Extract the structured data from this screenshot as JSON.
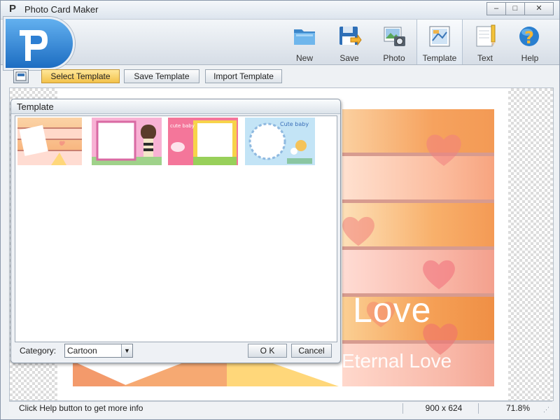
{
  "window": {
    "title": "Photo Card Maker",
    "buttons": {
      "minimize": "–",
      "maximize": "□",
      "close": "✕"
    }
  },
  "toolbar": {
    "items": [
      {
        "label": "New",
        "icon": "folder-icon"
      },
      {
        "label": "Save",
        "icon": "save-icon"
      },
      {
        "label": "Photo",
        "icon": "photo-icon"
      },
      {
        "label": "Template",
        "icon": "template-icon",
        "active": true
      },
      {
        "label": "Text",
        "icon": "text-icon"
      },
      {
        "label": "Help",
        "icon": "help-icon"
      }
    ]
  },
  "subtoolbar": {
    "select_label": "Select Template",
    "save_label": "Save Template",
    "import_label": "Import Template"
  },
  "canvas": {
    "love_text": "Love",
    "eternal_text": "Eternal Love"
  },
  "dialog": {
    "title": "Template",
    "thumbnails": [
      {
        "name": "pink-orange-planks",
        "colors": [
          "#f7b27a",
          "#ffd0c8"
        ]
      },
      {
        "name": "pink-frame-kid",
        "colors": [
          "#f59bc4",
          "#ffffff"
        ]
      },
      {
        "name": "cute-baby-pink",
        "colors": [
          "#f36c8f",
          "#f7e24f"
        ],
        "text": "cute baby"
      },
      {
        "name": "cute-baby-blue",
        "colors": [
          "#a9d6f2",
          "#ffffff"
        ],
        "text": "Cute baby"
      }
    ],
    "category_label": "Category:",
    "category_value": "Cartoon",
    "ok_label": "O K",
    "cancel_label": "Cancel"
  },
  "status": {
    "message": "Click Help button to get more info",
    "size": "900 x 624",
    "zoom": "71.8%"
  }
}
